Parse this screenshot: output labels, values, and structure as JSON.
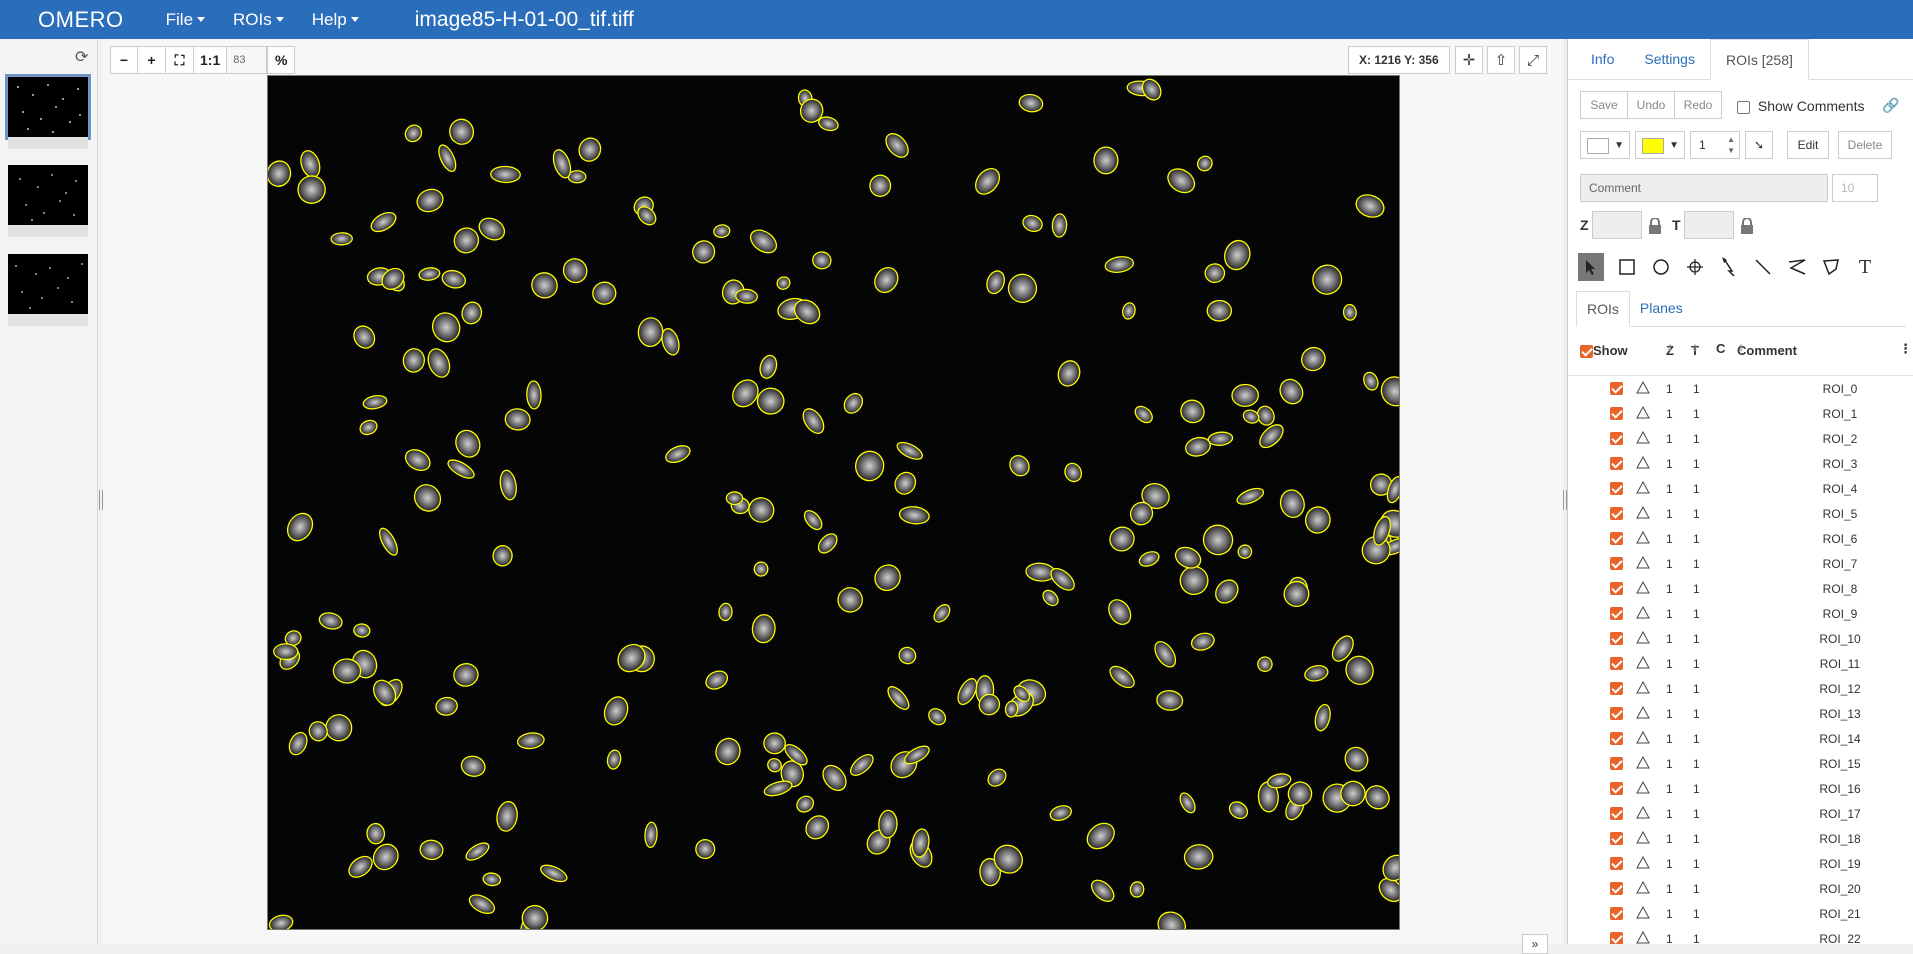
{
  "app": {
    "brand": "OMERO",
    "image_title": "image85-H-01-00_tif.tiff"
  },
  "menu": [
    {
      "label": "File"
    },
    {
      "label": "ROIs"
    },
    {
      "label": "Help"
    }
  ],
  "viewer": {
    "zoom_out": "−",
    "zoom_in": "+",
    "fit": "⛶",
    "one_to_one": "1:1",
    "zoom_value": "83",
    "zoom_unit": "%",
    "coords": "X: 1216 Y: 356",
    "expand_label": "»"
  },
  "tabs": [
    {
      "label": "Info"
    },
    {
      "label": "Settings"
    },
    {
      "label": "ROIs [258]"
    }
  ],
  "roi_toolbar": {
    "save": "Save",
    "undo": "Undo",
    "redo": "Redo",
    "show_comments": "Show Comments",
    "stroke_width": "1",
    "edit": "Edit",
    "delete": "Delete",
    "comment_placeholder": "Comment",
    "font_size": "10",
    "z_label": "Z",
    "t_label": "T",
    "fill_color": "#ffffff",
    "stroke_color": "#ffff00"
  },
  "subtabs": [
    {
      "label": "ROIs"
    },
    {
      "label": "Planes"
    }
  ],
  "roi_table": {
    "headers": {
      "show": "Show",
      "z": "Z",
      "t": "T",
      "c": "C",
      "comment": "Comment"
    },
    "rows": [
      {
        "z": "1",
        "t": "1",
        "name": "ROI_0"
      },
      {
        "z": "1",
        "t": "1",
        "name": "ROI_1"
      },
      {
        "z": "1",
        "t": "1",
        "name": "ROI_2"
      },
      {
        "z": "1",
        "t": "1",
        "name": "ROI_3"
      },
      {
        "z": "1",
        "t": "1",
        "name": "ROI_4"
      },
      {
        "z": "1",
        "t": "1",
        "name": "ROI_5"
      },
      {
        "z": "1",
        "t": "1",
        "name": "ROI_6"
      },
      {
        "z": "1",
        "t": "1",
        "name": "ROI_7"
      },
      {
        "z": "1",
        "t": "1",
        "name": "ROI_8"
      },
      {
        "z": "1",
        "t": "1",
        "name": "ROI_9"
      },
      {
        "z": "1",
        "t": "1",
        "name": "ROI_10"
      },
      {
        "z": "1",
        "t": "1",
        "name": "ROI_11"
      },
      {
        "z": "1",
        "t": "1",
        "name": "ROI_12"
      },
      {
        "z": "1",
        "t": "1",
        "name": "ROI_13"
      },
      {
        "z": "1",
        "t": "1",
        "name": "ROI_14"
      },
      {
        "z": "1",
        "t": "1",
        "name": "ROI_15"
      },
      {
        "z": "1",
        "t": "1",
        "name": "ROI_16"
      },
      {
        "z": "1",
        "t": "1",
        "name": "ROI_17"
      },
      {
        "z": "1",
        "t": "1",
        "name": "ROI_18"
      },
      {
        "z": "1",
        "t": "1",
        "name": "ROI_19"
      },
      {
        "z": "1",
        "t": "1",
        "name": "ROI_20"
      },
      {
        "z": "1",
        "t": "1",
        "name": "ROI_21"
      },
      {
        "z": "1",
        "t": "1",
        "name": "ROI_22"
      }
    ]
  }
}
